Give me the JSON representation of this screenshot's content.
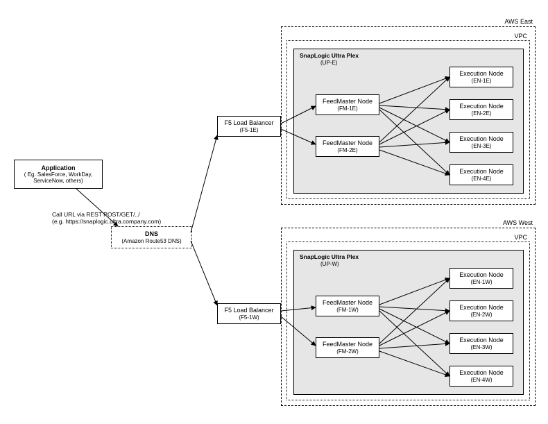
{
  "app": {
    "title": "Application",
    "subtitle": "( Eg. SalesForce, WorkDay,\nServiceNow, others)"
  },
  "call_label": "Call URL via REST POST/GET/../\n(e.g. https://snaplogic.ultra.company.com)",
  "dns": {
    "title": "DNS",
    "subtitle": "(Amazon Route53 DNS)"
  },
  "east": {
    "region_label": "AWS East",
    "vpc_label": "VPC",
    "plex_title": "SnapLogic Ultra Plex",
    "plex_sub": "(UP-E)",
    "lb": {
      "title": "F5 Load Balancer",
      "sub": "(F5-1E)"
    },
    "fm": [
      {
        "title": "FeedMaster Node",
        "sub": "(FM-1E)"
      },
      {
        "title": "FeedMaster Node",
        "sub": "(FM-2E)"
      }
    ],
    "en": [
      {
        "title": "Execution Node",
        "sub": "(EN-1E)"
      },
      {
        "title": "Execution Node",
        "sub": "(EN-2E)"
      },
      {
        "title": "Execution Node",
        "sub": "(EN-3E)"
      },
      {
        "title": "Execution Node",
        "sub": "(EN-4E)"
      }
    ]
  },
  "west": {
    "region_label": "AWS West",
    "vpc_label": "VPC",
    "plex_title": "SnapLogic Ultra Plex",
    "plex_sub": "(UP-W)",
    "lb": {
      "title": "F5 Load Balancer",
      "sub": "(F5-1W)"
    },
    "fm": [
      {
        "title": "FeedMaster Node",
        "sub": "(FM-1W)"
      },
      {
        "title": "FeedMaster Node",
        "sub": "(FM-2W)"
      }
    ],
    "en": [
      {
        "title": "Execution Node",
        "sub": "(EN-1W)"
      },
      {
        "title": "Execution Node",
        "sub": "(EN-2W)"
      },
      {
        "title": "Execution Node",
        "sub": "(EN-3W)"
      },
      {
        "title": "Execution Node",
        "sub": "(EN-4W)"
      }
    ]
  },
  "chart_data": {
    "type": "diagram",
    "nodes": [
      {
        "id": "app",
        "label": "Application"
      },
      {
        "id": "dns",
        "label": "DNS (Amazon Route53 DNS)"
      },
      {
        "id": "f5-1e",
        "label": "F5 Load Balancer (F5-1E)",
        "region": "AWS East"
      },
      {
        "id": "f5-1w",
        "label": "F5 Load Balancer (F5-1W)",
        "region": "AWS West"
      },
      {
        "id": "fm-1e",
        "label": "FeedMaster Node (FM-1E)",
        "region": "AWS East"
      },
      {
        "id": "fm-2e",
        "label": "FeedMaster Node (FM-2E)",
        "region": "AWS East"
      },
      {
        "id": "fm-1w",
        "label": "FeedMaster Node (FM-1W)",
        "region": "AWS West"
      },
      {
        "id": "fm-2w",
        "label": "FeedMaster Node (FM-2W)",
        "region": "AWS West"
      },
      {
        "id": "en-1e",
        "label": "Execution Node (EN-1E)",
        "region": "AWS East"
      },
      {
        "id": "en-2e",
        "label": "Execution Node (EN-2E)",
        "region": "AWS East"
      },
      {
        "id": "en-3e",
        "label": "Execution Node (EN-3E)",
        "region": "AWS East"
      },
      {
        "id": "en-4e",
        "label": "Execution Node (EN-4E)",
        "region": "AWS East"
      },
      {
        "id": "en-1w",
        "label": "Execution Node (EN-1W)",
        "region": "AWS West"
      },
      {
        "id": "en-2w",
        "label": "Execution Node (EN-2W)",
        "region": "AWS West"
      },
      {
        "id": "en-3w",
        "label": "Execution Node (EN-3W)",
        "region": "AWS West"
      },
      {
        "id": "en-4w",
        "label": "Execution Node (EN-4W)",
        "region": "AWS West"
      }
    ],
    "edges": [
      {
        "from": "app",
        "to": "dns",
        "label": "Call URL via REST POST/GET/../"
      },
      {
        "from": "dns",
        "to": "f5-1e"
      },
      {
        "from": "dns",
        "to": "f5-1w"
      },
      {
        "from": "f5-1e",
        "to": "fm-1e"
      },
      {
        "from": "f5-1e",
        "to": "fm-2e"
      },
      {
        "from": "f5-1w",
        "to": "fm-1w"
      },
      {
        "from": "f5-1w",
        "to": "fm-2w"
      },
      {
        "from": "fm-1e",
        "to": "en-1e"
      },
      {
        "from": "fm-1e",
        "to": "en-2e"
      },
      {
        "from": "fm-1e",
        "to": "en-3e"
      },
      {
        "from": "fm-1e",
        "to": "en-4e"
      },
      {
        "from": "fm-2e",
        "to": "en-1e"
      },
      {
        "from": "fm-2e",
        "to": "en-2e"
      },
      {
        "from": "fm-2e",
        "to": "en-3e"
      },
      {
        "from": "fm-2e",
        "to": "en-4e"
      },
      {
        "from": "fm-1w",
        "to": "en-1w"
      },
      {
        "from": "fm-1w",
        "to": "en-2w"
      },
      {
        "from": "fm-1w",
        "to": "en-3w"
      },
      {
        "from": "fm-1w",
        "to": "en-4w"
      },
      {
        "from": "fm-2w",
        "to": "en-1w"
      },
      {
        "from": "fm-2w",
        "to": "en-2w"
      },
      {
        "from": "fm-2w",
        "to": "en-3w"
      },
      {
        "from": "fm-2w",
        "to": "en-4w"
      }
    ],
    "containers": [
      {
        "id": "aws-east",
        "label": "AWS East",
        "children": [
          "vpc-east"
        ]
      },
      {
        "id": "vpc-east",
        "label": "VPC",
        "children": [
          "plex-east",
          "en-1e",
          "en-2e",
          "en-3e",
          "en-4e"
        ]
      },
      {
        "id": "plex-east",
        "label": "SnapLogic Ultra Plex (UP-E)",
        "children": [
          "fm-1e",
          "fm-2e"
        ]
      },
      {
        "id": "aws-west",
        "label": "AWS West",
        "children": [
          "vpc-west"
        ]
      },
      {
        "id": "vpc-west",
        "label": "VPC",
        "children": [
          "plex-west",
          "en-1w",
          "en-2w",
          "en-3w",
          "en-4w"
        ]
      },
      {
        "id": "plex-west",
        "label": "SnapLogic Ultra Plex (UP-W)",
        "children": [
          "fm-1w",
          "fm-2w"
        ]
      }
    ]
  }
}
